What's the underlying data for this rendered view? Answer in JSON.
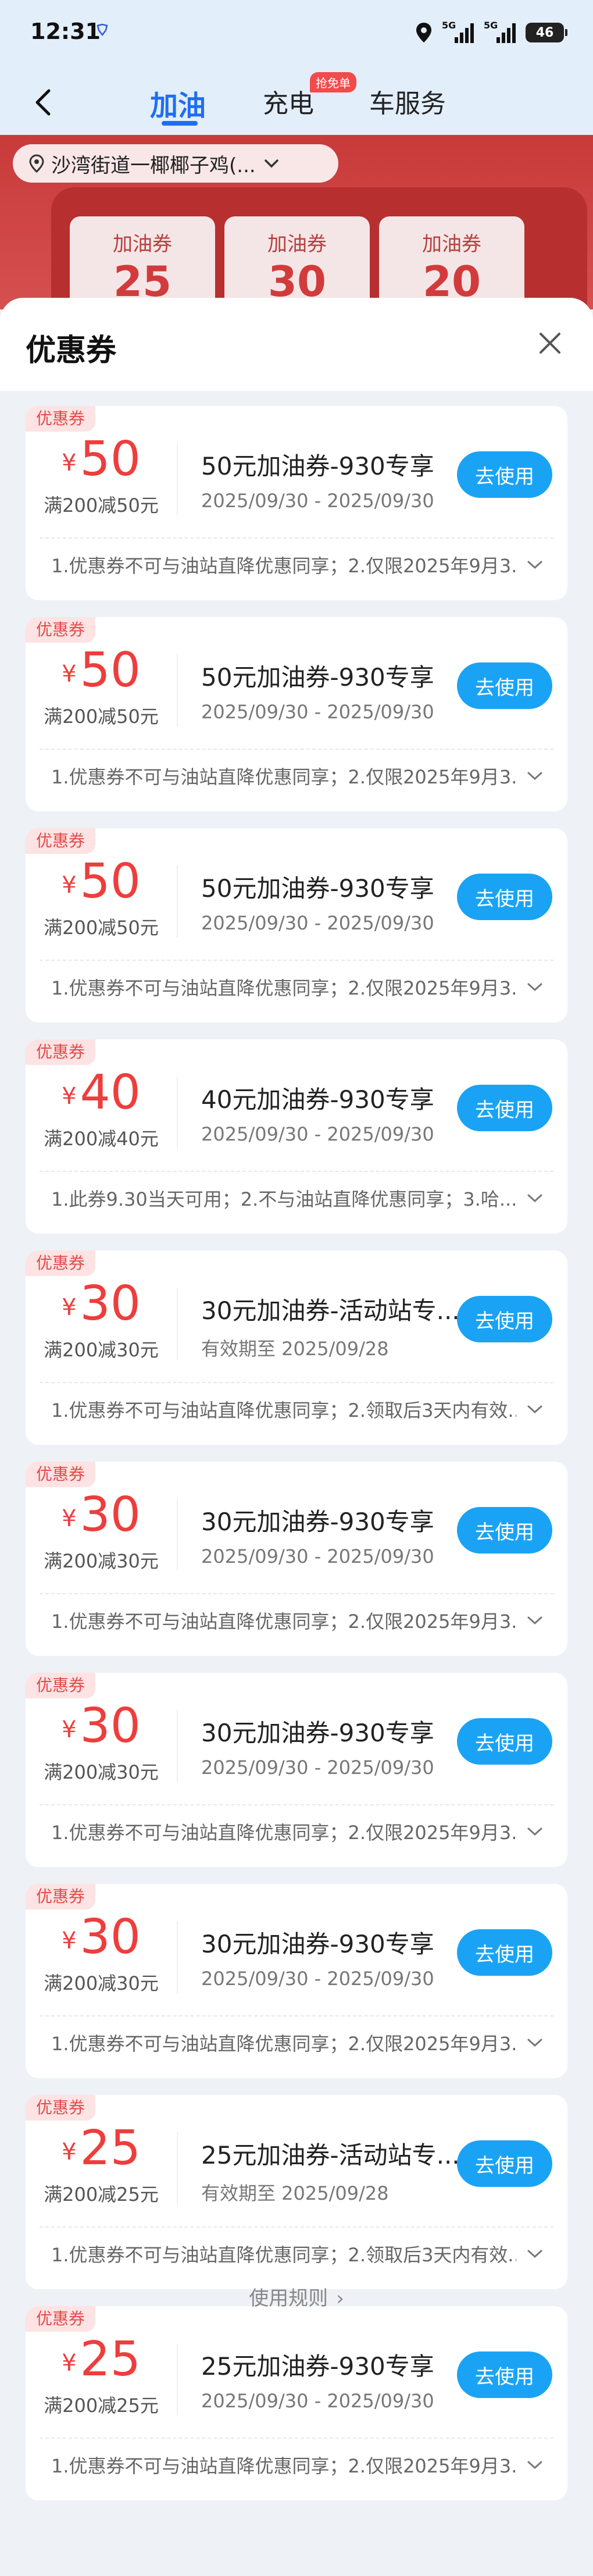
{
  "status_bar": {
    "time": "12:31",
    "battery": "46",
    "signal_1": "5G",
    "signal_2": "5G"
  },
  "nav": {
    "tabs": [
      {
        "label": "加油",
        "active": true
      },
      {
        "label": "充电",
        "badge": "抢免单"
      },
      {
        "label": "车服务"
      }
    ]
  },
  "banner": {
    "location": "沙湾街道一椰椰子鸡(...",
    "cards": [
      {
        "title": "加油券",
        "value": "25"
      },
      {
        "title": "加油券",
        "value": "30"
      },
      {
        "title": "加油券",
        "value": "20"
      }
    ]
  },
  "sheet": {
    "title": "优惠券",
    "coupons": [
      {
        "tag": "优惠券",
        "currency": "¥",
        "amount": "50",
        "condition": "满200减50元",
        "name": "50元加油券-930专享",
        "date": "2025/09/30 - 2025/09/30",
        "button": "去使用",
        "note": "1.优惠券不可与油站直降优惠同享；2.仅限2025年9月3..."
      },
      {
        "tag": "优惠券",
        "currency": "¥",
        "amount": "50",
        "condition": "满200减50元",
        "name": "50元加油券-930专享",
        "date": "2025/09/30 - 2025/09/30",
        "button": "去使用",
        "note": "1.优惠券不可与油站直降优惠同享；2.仅限2025年9月3..."
      },
      {
        "tag": "优惠券",
        "currency": "¥",
        "amount": "50",
        "condition": "满200减50元",
        "name": "50元加油券-930专享",
        "date": "2025/09/30 - 2025/09/30",
        "button": "去使用",
        "note": "1.优惠券不可与油站直降优惠同享；2.仅限2025年9月3..."
      },
      {
        "tag": "优惠券",
        "currency": "¥",
        "amount": "40",
        "condition": "满200减40元",
        "name": "40元加油券-930专享",
        "date": "2025/09/30 - 2025/09/30",
        "button": "去使用",
        "note": "1.此券9.30当天可用；2.不与油站直降优惠同享；3.哈..."
      },
      {
        "tag": "优惠券",
        "currency": "¥",
        "amount": "30",
        "condition": "满200减30元",
        "name": "30元加油券-活动站专...",
        "date": "有效期至 2025/09/28",
        "button": "去使用",
        "note": "1.优惠券不可与油站直降优惠同享；2.领取后3天内有效..."
      },
      {
        "tag": "优惠券",
        "currency": "¥",
        "amount": "30",
        "condition": "满200减30元",
        "name": "30元加油券-930专享",
        "date": "2025/09/30 - 2025/09/30",
        "button": "去使用",
        "note": "1.优惠券不可与油站直降优惠同享；2.仅限2025年9月3..."
      },
      {
        "tag": "优惠券",
        "currency": "¥",
        "amount": "30",
        "condition": "满200减30元",
        "name": "30元加油券-930专享",
        "date": "2025/09/30 - 2025/09/30",
        "button": "去使用",
        "note": "1.优惠券不可与油站直降优惠同享；2.仅限2025年9月3..."
      },
      {
        "tag": "优惠券",
        "currency": "¥",
        "amount": "30",
        "condition": "满200减30元",
        "name": "30元加油券-930专享",
        "date": "2025/09/30 - 2025/09/30",
        "button": "去使用",
        "note": "1.优惠券不可与油站直降优惠同享；2.仅限2025年9月3..."
      },
      {
        "tag": "优惠券",
        "currency": "¥",
        "amount": "25",
        "condition": "满200减25元",
        "name": "25元加油券-活动站专...",
        "date": "有效期至 2025/09/28",
        "button": "去使用",
        "note": "1.优惠券不可与油站直降优惠同享；2.领取后3天内有效..."
      },
      {
        "tag": "优惠券",
        "currency": "¥",
        "amount": "25",
        "condition": "满200减25元",
        "name": "25元加油券-930专享",
        "date": "2025/09/30 - 2025/09/30",
        "button": "去使用",
        "note": "1.优惠券不可与油站直降优惠同享；2.仅限2025年9月3..."
      }
    ],
    "rules_link": "使用规则"
  },
  "colors": {
    "accent": "#1f6ef0",
    "button": "#1aa3f5",
    "amount": "#ee3d3d",
    "banner": "#c83a3a"
  }
}
